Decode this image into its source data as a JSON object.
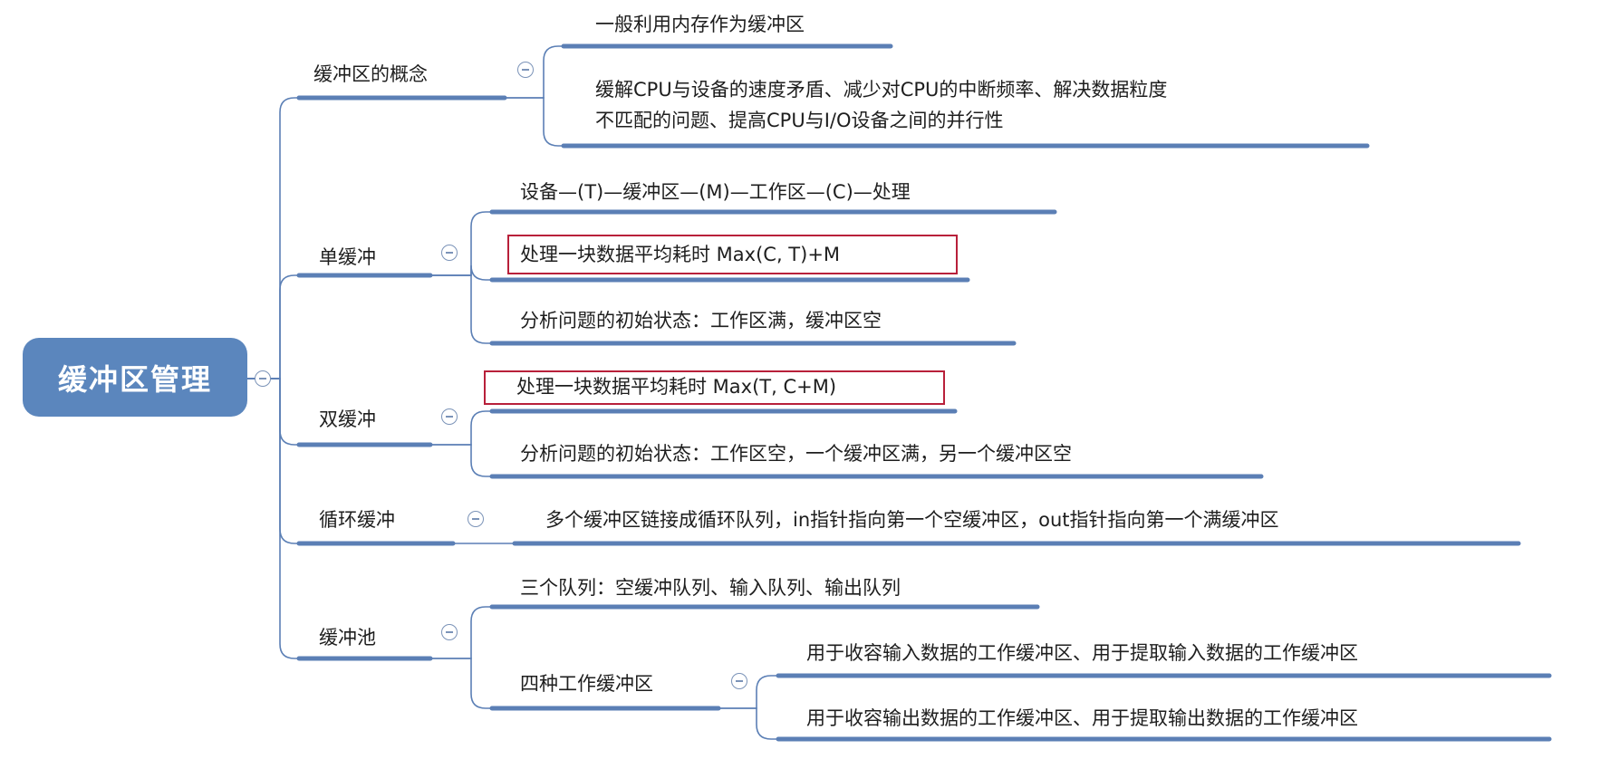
{
  "root": {
    "label": "缓冲区管理"
  },
  "branches": [
    {
      "label": "缓冲区的概念",
      "children": [
        {
          "label": "一般利用内存作为缓冲区"
        },
        {
          "label_line1": "缓解CPU与设备的速度矛盾、减少对CPU的中断频率、解决数据粒度",
          "label_line2": "不匹配的问题、提高CPU与I/O设备之间的并行性"
        }
      ]
    },
    {
      "label": "单缓冲",
      "children": [
        {
          "label": "设备—(T)—缓冲区—(M)—工作区—(C)—处理"
        },
        {
          "label": "处理一块数据平均耗时 Max(C, T)+M",
          "highlighted": true
        },
        {
          "label": "分析问题的初始状态：工作区满，缓冲区空"
        }
      ]
    },
    {
      "label": "双缓冲",
      "children": [
        {
          "label": "处理一块数据平均耗时 Max(T, C+M)",
          "highlighted": true
        },
        {
          "label": "分析问题的初始状态：工作区空，一个缓冲区满，另一个缓冲区空"
        }
      ]
    },
    {
      "label": "循环缓冲",
      "children": [
        {
          "label": "多个缓冲区链接成循环队列，in指针指向第一个空缓冲区，out指针指向第一个满缓冲区"
        }
      ]
    },
    {
      "label": "缓冲池",
      "children": [
        {
          "label": "三个队列：空缓冲队列、输入队列、输出队列"
        },
        {
          "label": "四种工作缓冲区",
          "children": [
            {
              "label": "用于收容输入数据的工作缓冲区、用于提取输入数据的工作缓冲区"
            },
            {
              "label": "用于收容输出数据的工作缓冲区、用于提取输出数据的工作缓冲区"
            }
          ]
        }
      ]
    }
  ],
  "colors": {
    "root_fill": "#5b86bd",
    "line": "#5b7fb5",
    "highlight_border": "#b8203a"
  }
}
